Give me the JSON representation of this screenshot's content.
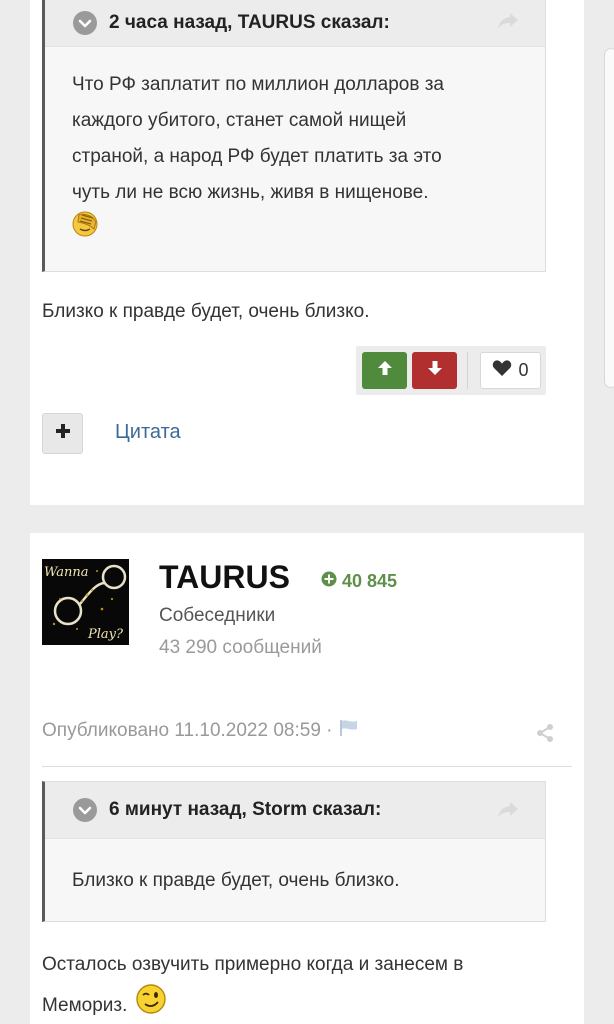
{
  "post1": {
    "quote": {
      "header": "2 часа назад, TAURUS сказал:",
      "lines": [
        "Что РФ заплатит по миллион долларов за",
        "каждого убитого, станет самой нищей",
        "страной, а народ РФ будет платить за это",
        "чуть ли не всю жизнь, живя в нищенове."
      ],
      "emoji_icon": "facepalm-emoji-icon"
    },
    "text": "Близко к правде будет, очень близко.",
    "reputation": {
      "like_count": "0"
    },
    "quote_label": "Цитата"
  },
  "post2": {
    "author": {
      "name": "TAURUS",
      "reputation": "40 845",
      "group": "Собеседники",
      "post_count": "43 290 сообщений",
      "avatar_text_top": "Wanna",
      "avatar_text_bottom": "Play?"
    },
    "meta": {
      "published": "Опубликовано 11.10.2022 08:59 ·"
    },
    "quote": {
      "header": "6 минут назад, Storm сказал:",
      "text": "Близко к правде будет, очень близко."
    },
    "text_line1": "Осталось озвучить примерно когда и занесем в",
    "text_line2": "Мемориз.",
    "emoji_icon": "wink-emoji-icon"
  },
  "colors": {
    "upvote": "#4f8a3d",
    "downvote": "#b22f2f",
    "link": "#3c6a98",
    "reputation_positive": "#5f8f4a"
  }
}
